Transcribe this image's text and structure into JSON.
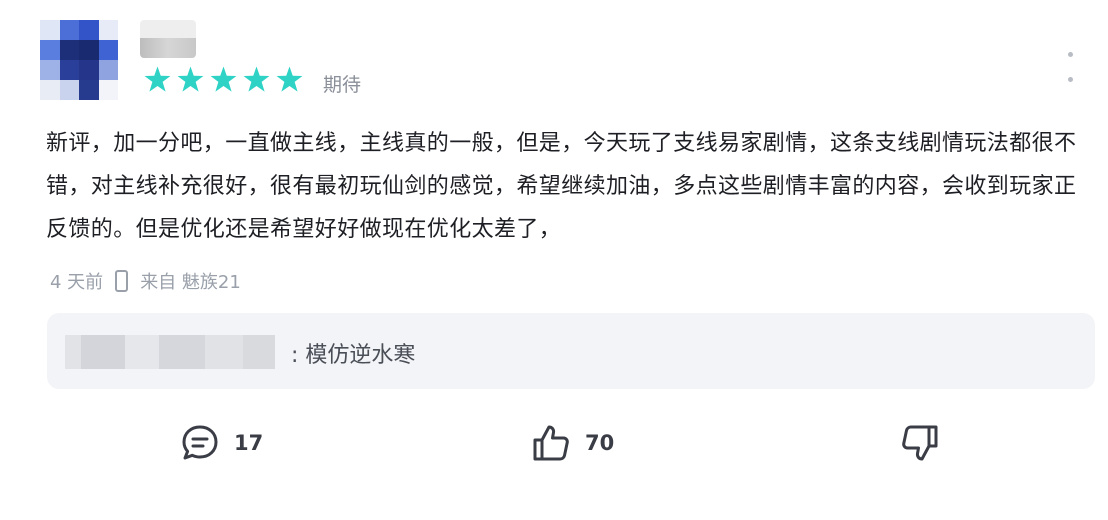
{
  "review": {
    "rating": 5,
    "rating_label": "期待",
    "star_color": "#2ed3c6",
    "text": "新评，加一分吧，一直做主线，主线真的一般，但是，今天玩了支线易家剧情，这条支线剧情玩法都很不错，对主线补充很好，很有最初玩仙剑的感觉，希望继续加油，多点这些剧情丰富的内容，会收到玩家正反馈的。但是优化还是希望好好做现在优化太差了，",
    "time": "4 天前",
    "source": "来自 魅族21"
  },
  "reply": {
    "text": ": 模仿逆水寒"
  },
  "actions": {
    "comment_count": "17",
    "like_count": "70"
  },
  "icons": {
    "more": "more-vertical-icon",
    "phone": "phone-icon",
    "comment": "comment-bubble-icon",
    "like": "thumbs-up-icon",
    "dislike": "thumbs-down-icon"
  }
}
